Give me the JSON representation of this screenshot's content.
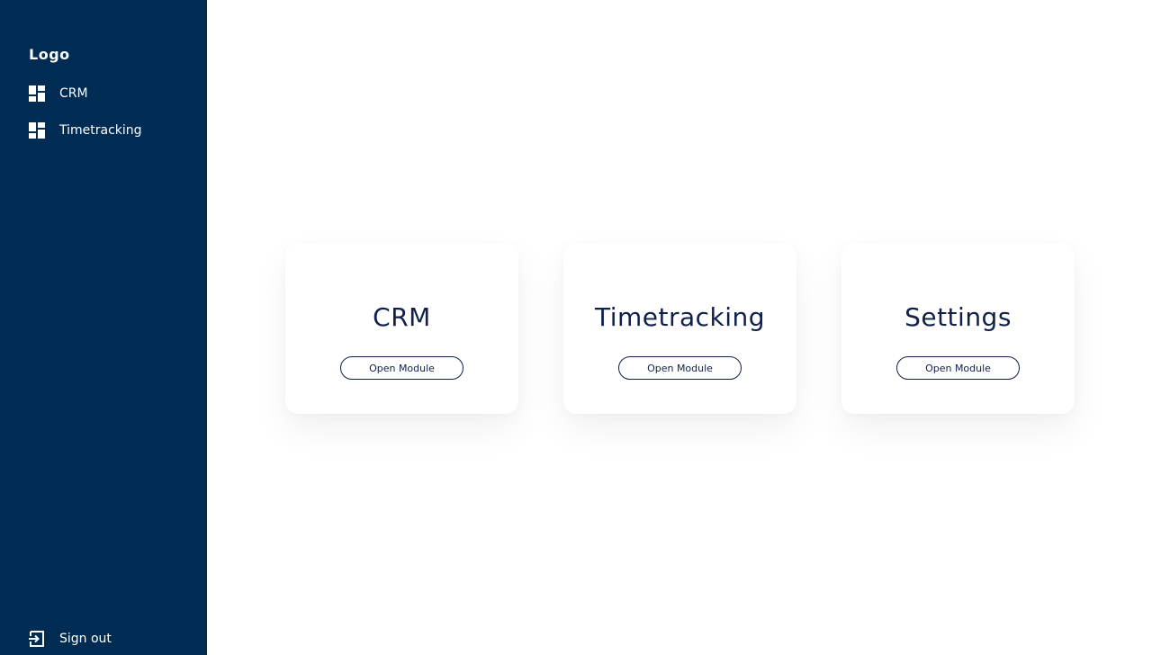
{
  "sidebar": {
    "logo": "Logo",
    "items": [
      {
        "label": "CRM",
        "icon": "dashboard-icon"
      },
      {
        "label": "Timetracking",
        "icon": "dashboard-icon"
      }
    ],
    "signout": {
      "label": "Sign out",
      "icon": "sign-out-icon"
    }
  },
  "main": {
    "cards": [
      {
        "title": "CRM",
        "button_label": "Open Module"
      },
      {
        "title": "Timetracking",
        "button_label": "Open Module"
      },
      {
        "title": "Settings",
        "button_label": "Open Module"
      }
    ]
  },
  "colors": {
    "sidebar_bg": "#002b52",
    "text_dark": "#10204a",
    "white": "#ffffff"
  }
}
